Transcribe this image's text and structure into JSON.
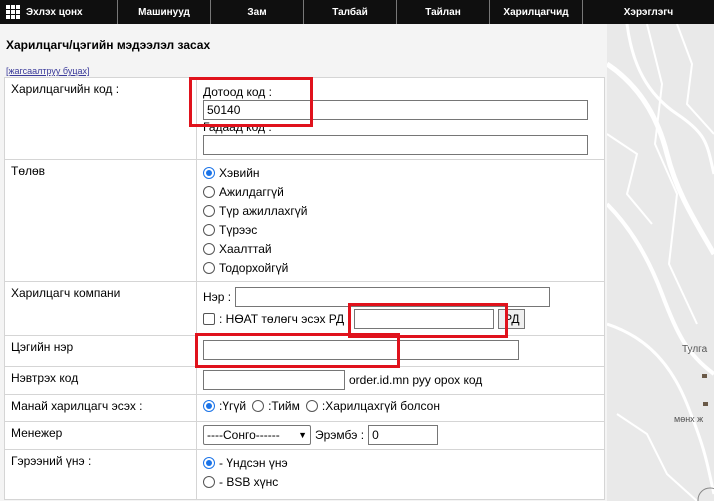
{
  "nav": {
    "items": [
      "Эхлэх цонх",
      "Машинууд",
      "Зам",
      "Талбай",
      "Тайлан",
      "Харилцагчид",
      "Хэрэглэгч"
    ]
  },
  "page": {
    "title": "Харилцагч/цэгийн мэдээлэл засах",
    "sort_link": "[жагсаалтруу буцах]"
  },
  "form": {
    "customer_code": {
      "label": "Харилцагчийн код :",
      "internal_label": "Дотоод код :",
      "internal_value": "50140",
      "external_label": "Гадаад код :",
      "external_value": ""
    },
    "status": {
      "label": "Төлөв",
      "options": [
        "Хэвийн",
        "Ажилдаггүй",
        "Түр ажиллахгүй",
        "Түрээс",
        "Хаалттай",
        "Тодорхойгүй"
      ],
      "selected": "Хэвийн"
    },
    "company": {
      "label": "Харилцагч компани",
      "name_label": "Нэр :",
      "name_value": "",
      "vat_label": ": НӨАТ төлөгч эсэх РД",
      "vat_value": "",
      "rd_button": "РД"
    },
    "point_name": {
      "label": "Цэгийн нэр",
      "value": ""
    },
    "login_code": {
      "label": "Нэвтрэх код",
      "value": "",
      "hint": "order.id.mn руу орох код"
    },
    "our_customer": {
      "label": "Манай харилцагч эсэх :",
      "options": [
        ":Үгүй",
        ":Тийм",
        ":Харилцахгүй болсон"
      ],
      "selected": ":Үгүй"
    },
    "manager": {
      "label": "Менежер",
      "select_value": "----Сонго------",
      "rank_label": "Эрэмбэ :",
      "rank_value": "0"
    },
    "contract_price": {
      "label": "Гэрээний үнэ :",
      "options": [
        "- Үндсэн үнэ",
        "- BSB хүнс"
      ],
      "selected": "- Үндсэн үнэ"
    }
  },
  "map": {
    "labels": [
      "Тулга",
      "мөнх ж"
    ]
  }
}
